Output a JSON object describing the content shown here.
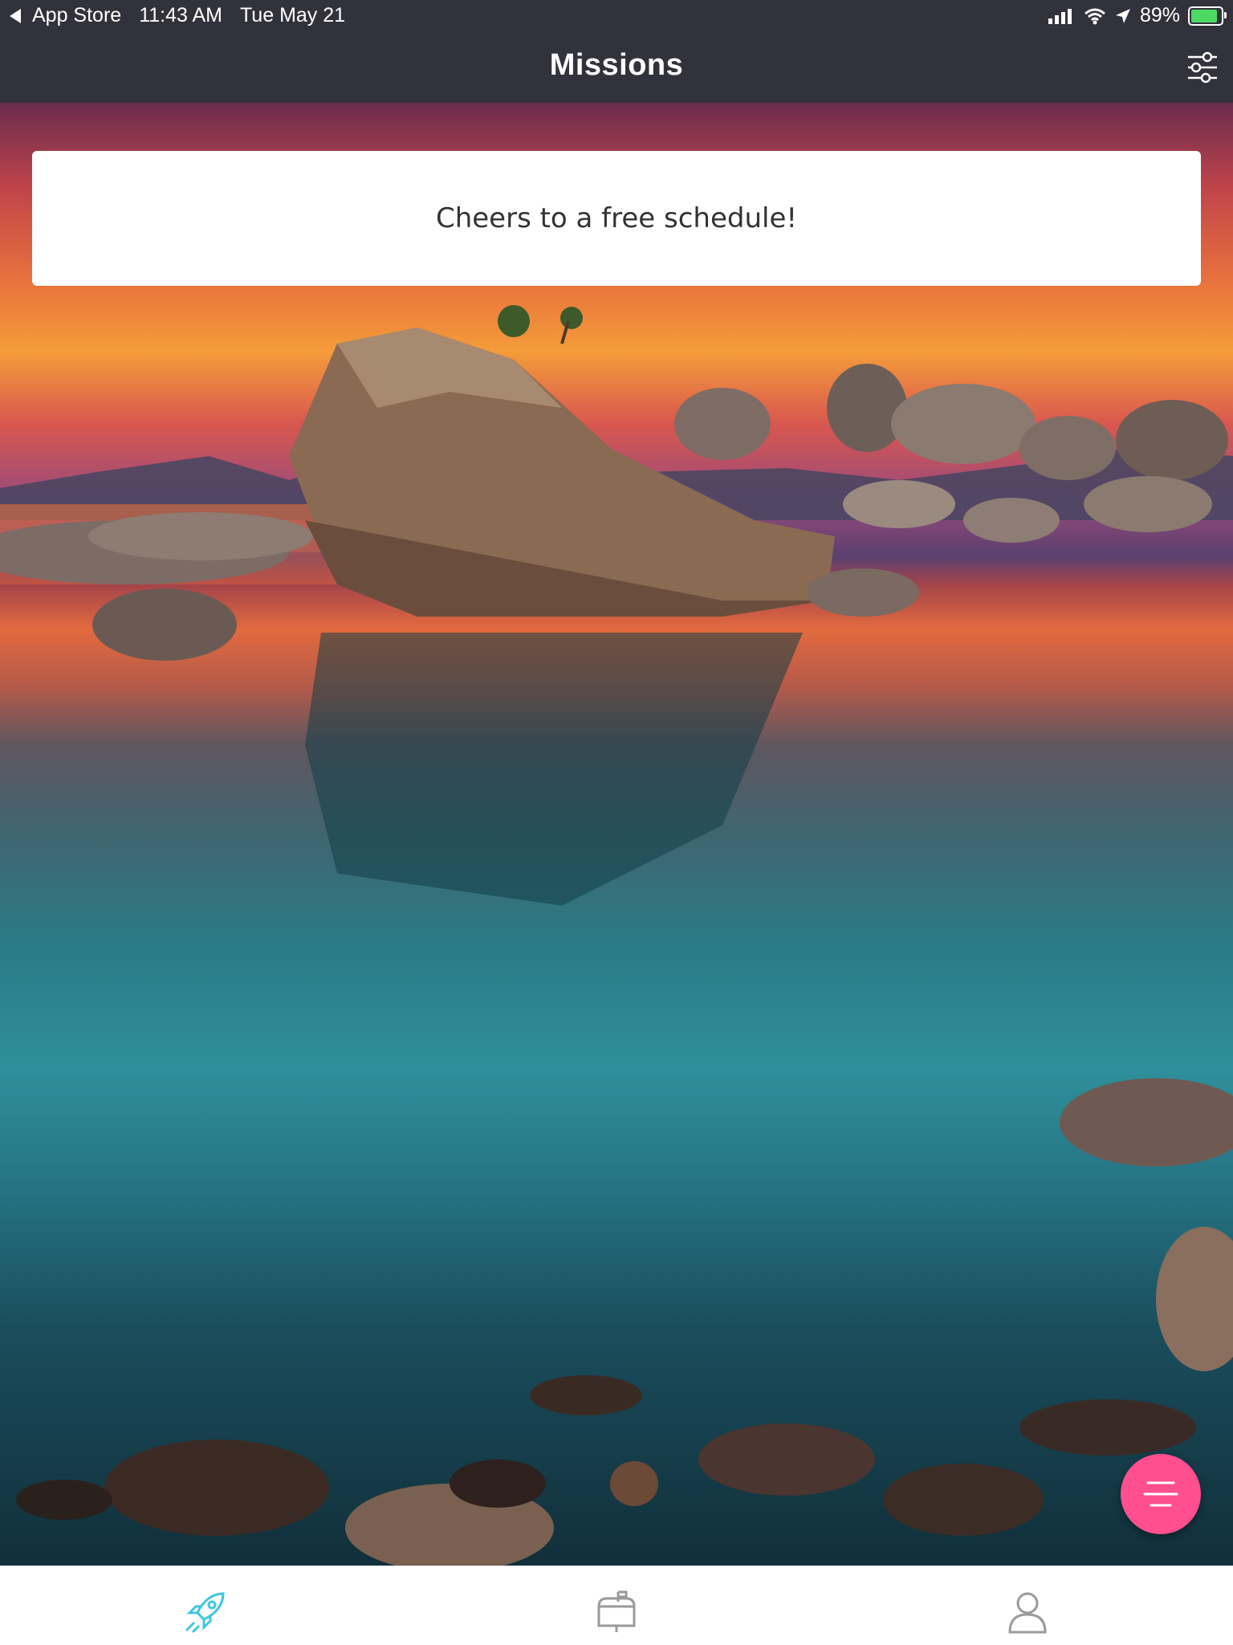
{
  "status_bar": {
    "back_label": "App Store",
    "time": "11:43 AM",
    "date": "Tue May 21",
    "battery": "89%",
    "battery_level": 0.89,
    "icons": [
      "signal-icon",
      "wifi-icon",
      "location-arrow-icon",
      "battery-charging-icon"
    ]
  },
  "nav": {
    "title": "Missions",
    "filter_icon": "sliders-icon"
  },
  "message": {
    "text": "Cheers to a free schedule!"
  },
  "fab": {
    "icon": "menu-lines-icon",
    "color": "#ff4f8e"
  },
  "tabs": [
    {
      "icon": "rocket-icon",
      "active": true,
      "color": "#3fc6e0"
    },
    {
      "icon": "mailbox-icon",
      "active": false,
      "color": "#9a9a9a"
    },
    {
      "icon": "user-icon",
      "active": false,
      "color": "#9a9a9a"
    }
  ],
  "colors": {
    "bar_background": "#32323c",
    "accent": "#3fc6e0",
    "fab": "#ff4f8e"
  }
}
